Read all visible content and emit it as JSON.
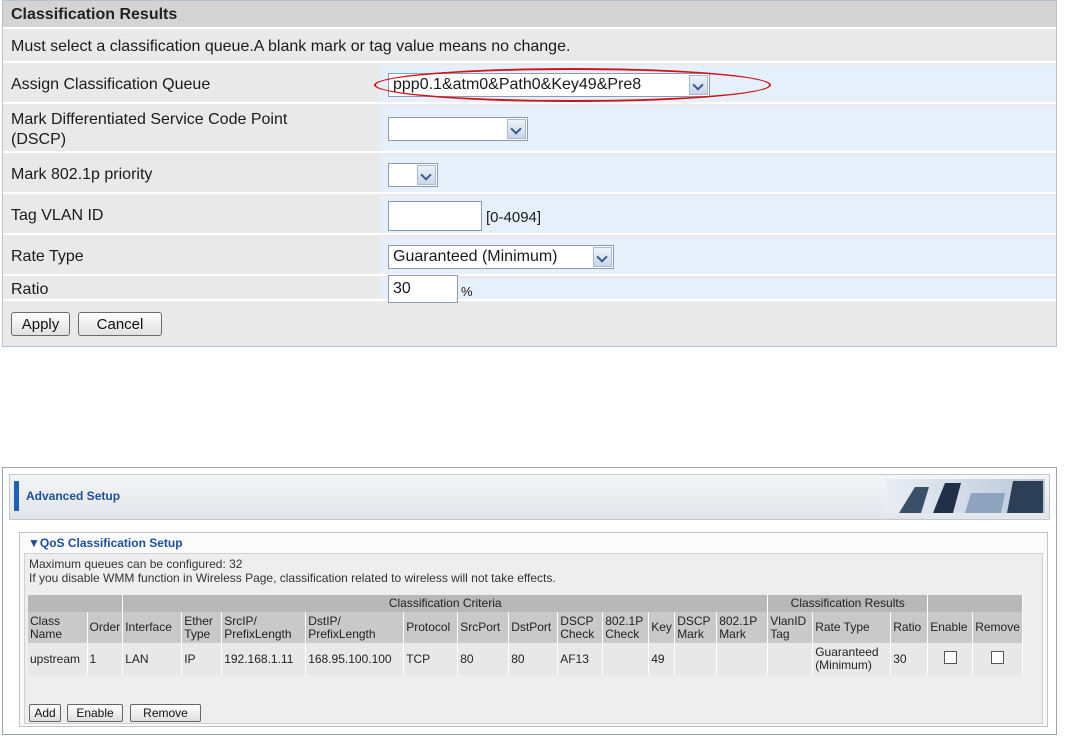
{
  "classification": {
    "title": "Classification Results",
    "note": "Must select a classification queue.A blank mark or tag value means no change.",
    "fields": {
      "queue_label": "Assign Classification Queue",
      "queue_value": "ppp0.1&atm0&Path0&Key49&Pre8",
      "dscp_label_line1": "Mark Differentiated Service Code Point",
      "dscp_label_line2": "(DSCP)",
      "dscp_value": "",
      "priority_label": "Mark 802.1p priority",
      "priority_value": "",
      "vlan_label": "Tag VLAN ID",
      "vlan_value": "",
      "vlan_range": "[0-4094]",
      "rate_label": "Rate Type",
      "rate_value": "Guaranteed (Minimum)",
      "ratio_label": "Ratio",
      "ratio_value": "30",
      "ratio_unit": "%"
    },
    "buttons": {
      "apply": "Apply",
      "cancel": "Cancel"
    },
    "highlight_color": "#d0141a"
  },
  "advanced": {
    "title": "Advanced Setup",
    "section_title": "▼QoS Classification Setup",
    "max_queues": "Maximum queues can be configured: 32",
    "wmm_note": "If you disable WMM function in Wireless Page, classification related to wireless will not take effects.",
    "table": {
      "group_criteria": "Classification Criteria",
      "group_results": "Classification Results",
      "headers": {
        "class_name": [
          "Class",
          "Name"
        ],
        "order": "Order",
        "interface": "Interface",
        "ether_type": [
          "Ether",
          "Type"
        ],
        "srcip": [
          "SrcIP/",
          "PrefixLength"
        ],
        "dstip": [
          "DstIP/",
          "PrefixLength"
        ],
        "protocol": "Protocol",
        "srcport": "SrcPort",
        "dstport": "DstPort",
        "dscp_check": [
          "DSCP",
          "Check"
        ],
        "p8021_check": [
          "802.1P",
          "Check"
        ],
        "key": "Key",
        "dscp_mark": [
          "DSCP",
          "Mark"
        ],
        "p8021_mark": [
          "802.1P",
          "Mark"
        ],
        "vlanid_tag": [
          "VlanID",
          "Tag"
        ],
        "rate_type": "Rate Type",
        "ratio": "Ratio",
        "enable": "Enable",
        "remove": "Remove"
      },
      "row": {
        "class_name": "upstream",
        "order": "1",
        "interface": "LAN",
        "ether_type": "IP",
        "srcip": "192.168.1.11",
        "dstip": "168.95.100.100",
        "protocol": "TCP",
        "srcport": "80",
        "dstport": "80",
        "dscp_check": "AF13",
        "p8021_check": "",
        "key": "49",
        "dscp_mark": "",
        "p8021_mark": "",
        "vlanid_tag": "",
        "rate_type": [
          "Guaranteed",
          "(Minimum)"
        ],
        "ratio": "30",
        "enable": false,
        "remove": false
      }
    },
    "buttons": {
      "add": "Add",
      "enable": "Enable",
      "remove": "Remove"
    }
  }
}
